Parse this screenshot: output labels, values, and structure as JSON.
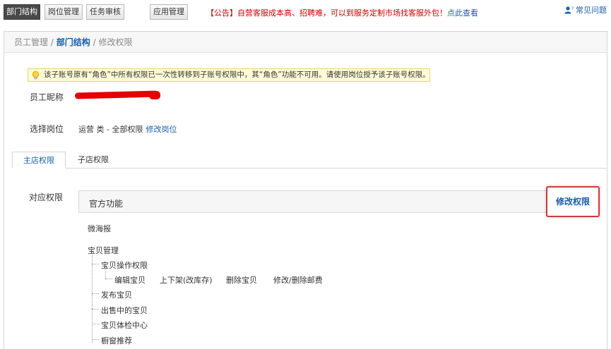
{
  "nav": {
    "tabs": [
      "部门结构",
      "岗位管理",
      "任务审核",
      "应用管理"
    ],
    "active_index": 0,
    "notice_text": "【公告】自营客服成本高、招聘难，可以到服务定制市场找客服外包！",
    "notice_link": "点此查看",
    "faq_label": "常见问题",
    "faq_icon": "user-question-icon"
  },
  "breadcrumb": {
    "item1": "员工管理",
    "item2": "部门结构",
    "item3": "修改权限",
    "separator": "/"
  },
  "tip": {
    "icon": "lightbulb-icon",
    "text": "该子账号原有“角色”中所有权限已一次性转移到子账号权限中，其“角色”功能不可用。请使用岗位授予该子账号权限。"
  },
  "form": {
    "nickname_label": "员工昵称",
    "post_label": "选择岗位",
    "post_value": "运营 类 - 全部权限",
    "post_edit_link": "修改岗位"
  },
  "subtabs": {
    "main": "主店权限",
    "sub": "子店权限"
  },
  "permissions": {
    "label": "对应权限",
    "section_title": "官方功能",
    "edit_button": "修改权限",
    "item_weihaibao": "微海报",
    "group_baobei": "宝贝管理",
    "child_operate": "宝贝操作权限",
    "op_edit": "编辑宝贝",
    "op_shelf": "上下架(改库存)",
    "op_delete": "删除宝贝",
    "op_postage": "修改/删除邮费",
    "child_publish": "发布宝贝",
    "child_onsale": "出售中的宝贝",
    "child_check": "宝贝体检中心",
    "child_window": "橱窗推荐"
  },
  "colors": {
    "link": "#1a5ea8",
    "notice_red": "#c00000",
    "highlight_border": "#d03a3a",
    "tip_bg": "#fffbd6"
  }
}
